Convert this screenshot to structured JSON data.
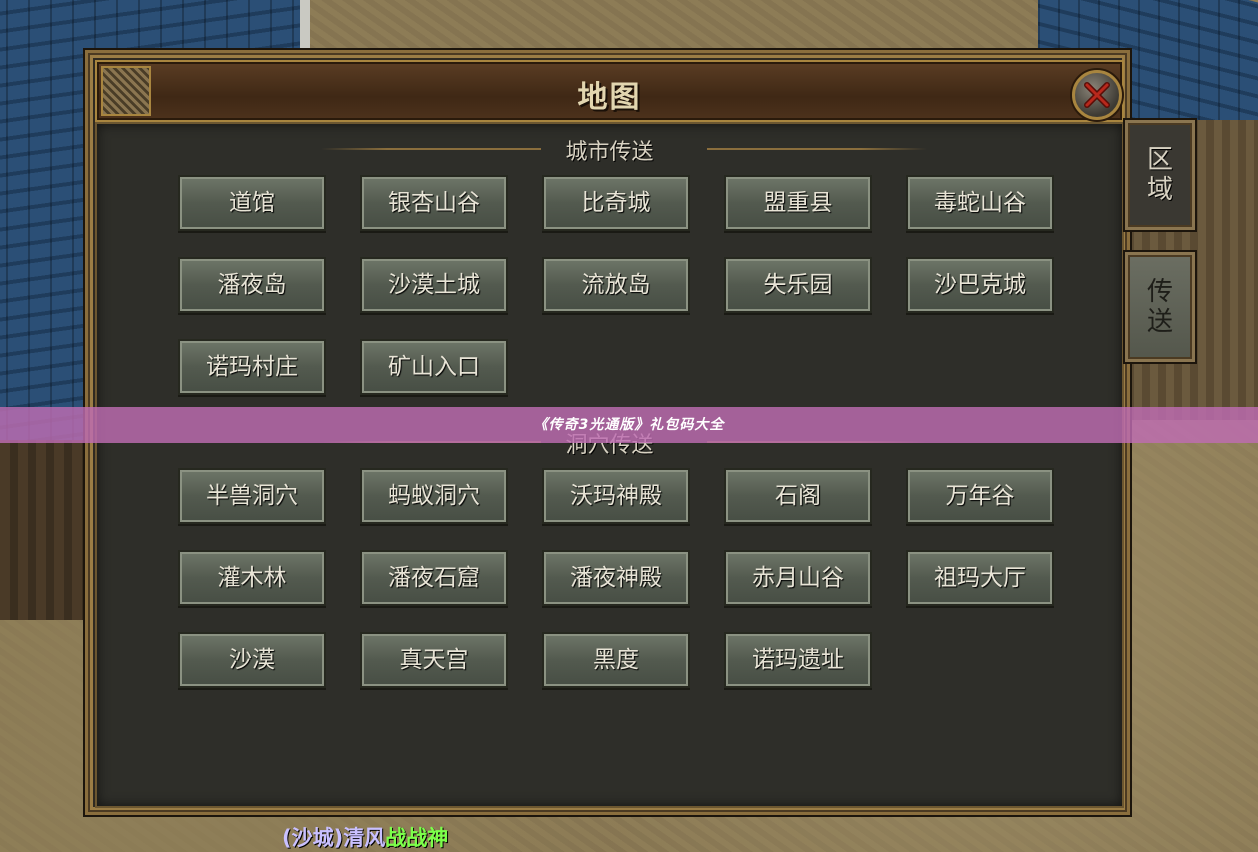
{
  "map_window": {
    "title": "地图",
    "close_icon": "close-x-icon"
  },
  "side_tabs": [
    {
      "label_line1": "区",
      "label_line2": "域",
      "active": false
    },
    {
      "label_line1": "传",
      "label_line2": "送",
      "active": true
    }
  ],
  "city_section": {
    "heading": "城市传送",
    "destinations": [
      "道馆",
      "银杏山谷",
      "比奇城",
      "盟重县",
      "毒蛇山谷",
      "潘夜岛",
      "沙漠土城",
      "流放岛",
      "失乐园",
      "沙巴克城",
      "诺玛村庄",
      "矿山入口"
    ]
  },
  "cave_section": {
    "heading": "洞穴传送",
    "destinations": [
      "半兽洞穴",
      "蚂蚁洞穴",
      "沃玛神殿",
      "石阁",
      "万年谷",
      "灌木林",
      "潘夜石窟",
      "潘夜神殿",
      "赤月山谷",
      "祖玛大厅",
      "沙漠",
      "真天宫",
      "黑度",
      "诺玛遗址"
    ]
  },
  "banner": {
    "text": "《传奇3光通版》礼包码大全"
  },
  "player": {
    "guild": "(沙城)清风",
    "title": "战战神"
  },
  "colors": {
    "banner_bg": "#be6cb2",
    "button_face": "#535a4f",
    "frame_gold": "#a8853f",
    "title_text": "#e2d6b0"
  }
}
